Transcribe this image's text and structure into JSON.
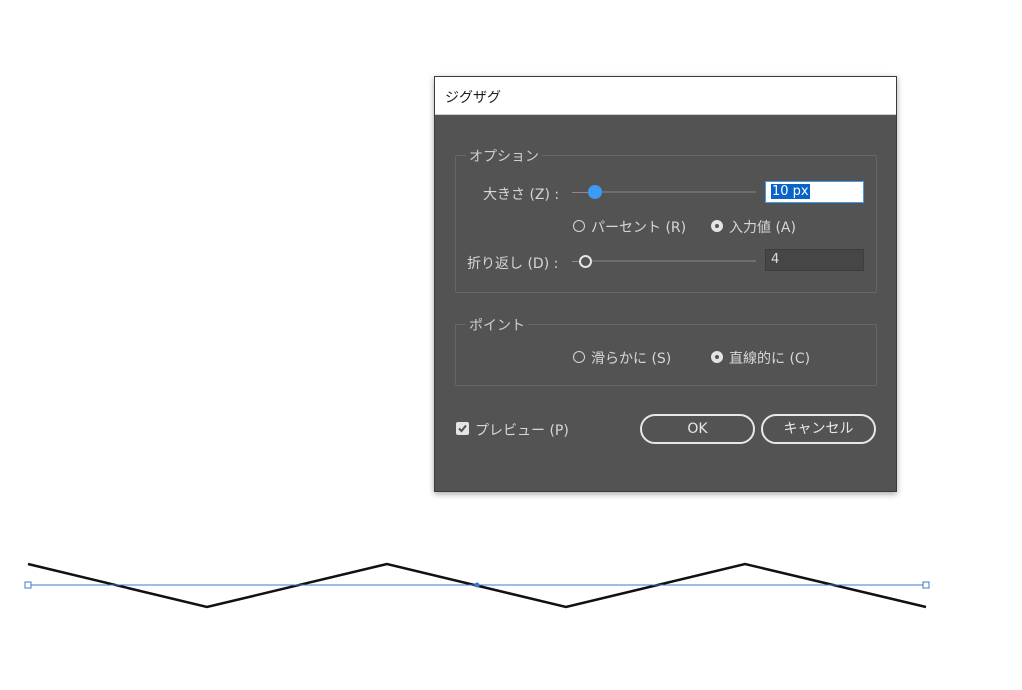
{
  "dialog": {
    "title": "ジグザグ",
    "options": {
      "group_label": "オプション",
      "size_label": "大きさ (Z) :",
      "size_value": "10 px",
      "mode_percent": "パーセント (R)",
      "mode_absolute": "入力値 (A)",
      "ridges_label": "折り返し (D) :",
      "ridges_value": "4"
    },
    "points": {
      "group_label": "ポイント",
      "smooth": "滑らかに (S)",
      "corner": "直線的に (C)"
    },
    "preview_label": "プレビュー (P)",
    "preview_checked": true,
    "ok_label": "OK",
    "cancel_label": "キャンセル"
  },
  "colors": {
    "dialog_bg": "#535353",
    "accent": "#3d9bf2",
    "path_guide": "#3f78c8",
    "zigzag_stroke": "#111111"
  }
}
